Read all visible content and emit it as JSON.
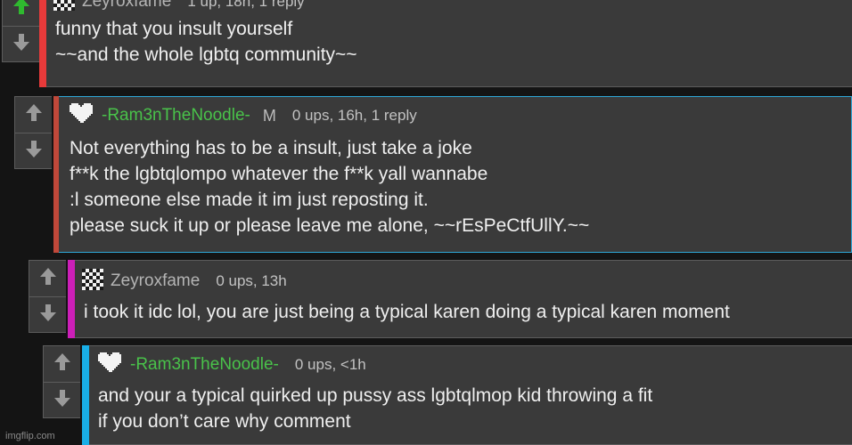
{
  "comments": [
    {
      "username": "Zeyroxfame",
      "badge": "",
      "stats": "1 up, 18h, 1 reply",
      "avatar_icon": "checker-avatar-icon",
      "accent_color": "#e83a3a",
      "upvoted": true,
      "lines": [
        "funny that you insult yourself",
        "~~and the whole lgbtq community~~"
      ]
    },
    {
      "username": "-Ram3nTheNoodle-",
      "badge": "M",
      "stats": "0 ups, 16h, 1 reply",
      "avatar_icon": "heart-avatar-icon",
      "accent_color": "#c0483a",
      "upvoted": false,
      "lines": [
        "Not everything has to be a insult, just take a joke",
        "f**k the lgbtqlompo whatever the f**k yall wannabe",
        ":l someone else made it im just reposting it.",
        "please suck it up or please leave me alone, ~~rEsPeCtfUllY.~~"
      ]
    },
    {
      "username": "Zeyroxfame",
      "badge": "",
      "stats": "0 ups, 13h",
      "avatar_icon": "checker-avatar-icon",
      "accent_color": "#cc1fb8",
      "upvoted": false,
      "lines": [
        "i took it idc lol, you are just being a typical karen doing a typical karen moment"
      ]
    },
    {
      "username": "-Ram3nTheNoodle-",
      "badge": "",
      "stats": "0 ups, <1h",
      "avatar_icon": "heart-avatar-icon",
      "accent_color": "#19aee6",
      "upvoted": false,
      "lines": [
        "and your a typical quirked up pussy ass lgbtqlmop kid throwing a fit",
        "if you don’t care why comment"
      ]
    }
  ],
  "watermark": "imgflip.com",
  "colors": {
    "upvote_active": "#2fb92f",
    "arrow_idle": "#9a9a9a",
    "username_green": "#49c24a"
  }
}
